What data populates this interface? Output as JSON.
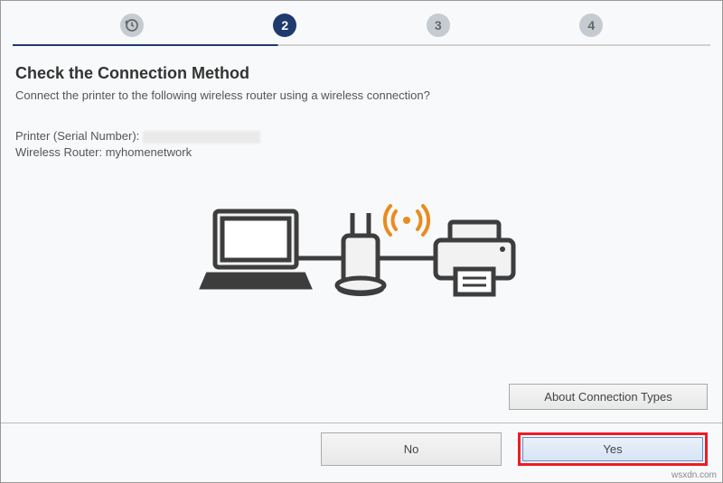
{
  "stepper": {
    "step1": "",
    "step2": "2",
    "step3": "3",
    "step4": "4"
  },
  "title": "Check the Connection Method",
  "subtitle": "Connect the printer to the following wireless router using a wireless connection?",
  "printer_label": "Printer (Serial Number): ",
  "printer_serial": "",
  "router_label": "Wireless Router: ",
  "router_name": "myhomenetwork",
  "about_btn": "About Connection Types",
  "no_btn": "No",
  "yes_btn": "Yes",
  "watermark": "wsxdn.com"
}
